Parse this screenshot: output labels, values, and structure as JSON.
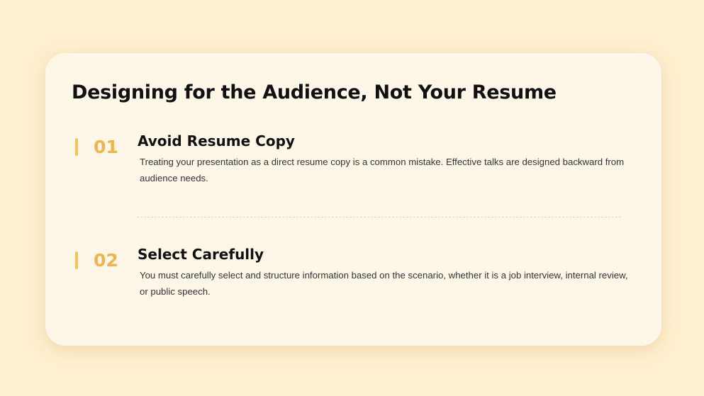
{
  "slide": {
    "title": "Designing for the Audience, Not Your Resume",
    "colors": {
      "page_background": "#FEEFCE",
      "card_background": "#FEF7E8",
      "accent": "#F0B44C",
      "marker": "#F5C25E",
      "text": "#111111"
    },
    "items": [
      {
        "number": "01",
        "heading": "Avoid Resume Copy",
        "description": "Treating your presentation as a direct resume copy is a common mistake. Effective talks are designed backward from audience needs."
      },
      {
        "number": "02",
        "heading": "Select Carefully",
        "description": "You must carefully select and structure information based on the scenario, whether it is a job interview, internal review, or public speech."
      }
    ]
  }
}
